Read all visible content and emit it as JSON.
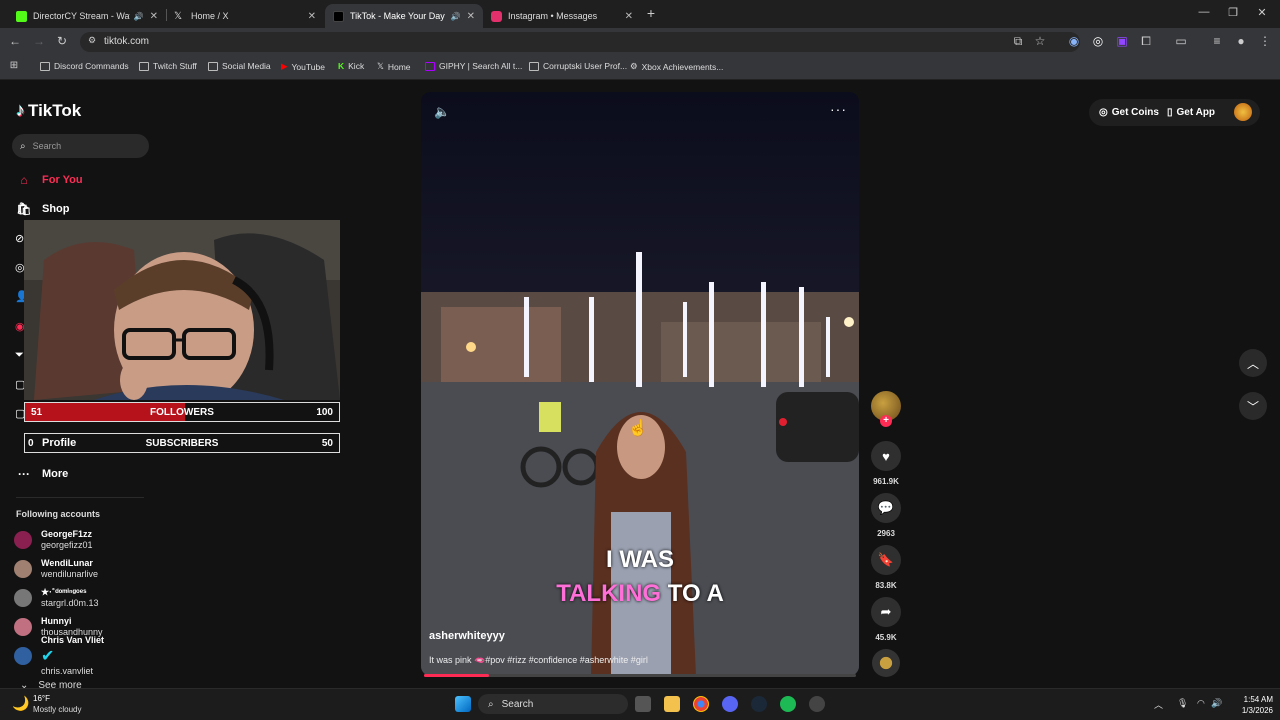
{
  "browser": {
    "tabs": [
      {
        "title": "DirectorCY Stream - Watch",
        "active": false,
        "audio": true,
        "favicon_color": "#53fc18"
      },
      {
        "title": "Home / X",
        "active": false,
        "audio": false,
        "favicon_color": "#ffffff"
      },
      {
        "title": "TikTok - Make Your Day",
        "active": true,
        "audio": true,
        "favicon_color": "#000000"
      },
      {
        "title": "Instagram • Messages",
        "active": false,
        "audio": false,
        "favicon_color": "#e1306c"
      }
    ],
    "new_tab": "+",
    "url": "tiktok.com",
    "bookmarks": [
      "Discord Commands",
      "Twitch Stuff",
      "Social Media",
      "YouTube",
      "Kick",
      "Home",
      "GIPHY | Search All t...",
      "Corruptski User Prof...",
      "Xbox Achievements..."
    ]
  },
  "tiktok": {
    "logo_text": "TikTok",
    "search_placeholder": "Search",
    "nav": {
      "for_you": "For You",
      "shop": "Shop",
      "profile": "Profile",
      "more": "More"
    },
    "following_title": "Following accounts",
    "following": [
      {
        "name": "GeorgeF1zz",
        "handle": "georgefizz01",
        "color": "#8a2050"
      },
      {
        "name": "WendiLunar",
        "handle": "wendilunarlive",
        "color": "#a08070"
      },
      {
        "name": "★·˚ᵈᵒᵐⁱⁿᵍᵒᵉˢ",
        "handle": "stargrl.d0m.13",
        "color": "#777777"
      },
      {
        "name": "Hunnyi",
        "handle": "thousandhunny",
        "color": "#c07080"
      },
      {
        "name": "Chris Van Vliet",
        "handle": "chris.vanvliet",
        "color": "#3060a0",
        "verified": true
      }
    ],
    "see_more": "See more",
    "top_right": {
      "get_coins": "Get Coins",
      "get_app": "Get App"
    },
    "video": {
      "author": "asherwhiteyyy",
      "description": "It was pink 🫦#pov #rizz #confidence #asherwhite #girl",
      "caption_line1": "I WAS",
      "caption_line2_highlight": "TALKING",
      "caption_line2_rest": "TO A",
      "progress": 0.15
    },
    "actions": {
      "likes": "961.9K",
      "comments": "2963",
      "saves": "83.8K",
      "shares": "45.9K"
    }
  },
  "overlay": {
    "followers_left": "51",
    "followers_label": "FOLLOWERS",
    "followers_right": "100",
    "followers_progress": 0.51,
    "subs_left": "0",
    "subs_label": "SUBSCRIBERS",
    "subs_right": "50",
    "subs_progress": 0.0
  },
  "taskbar": {
    "temperature": "16°F",
    "condition": "Mostly cloudy",
    "search": "Search",
    "time": "1:54 AM",
    "date": "1/3/2026"
  }
}
